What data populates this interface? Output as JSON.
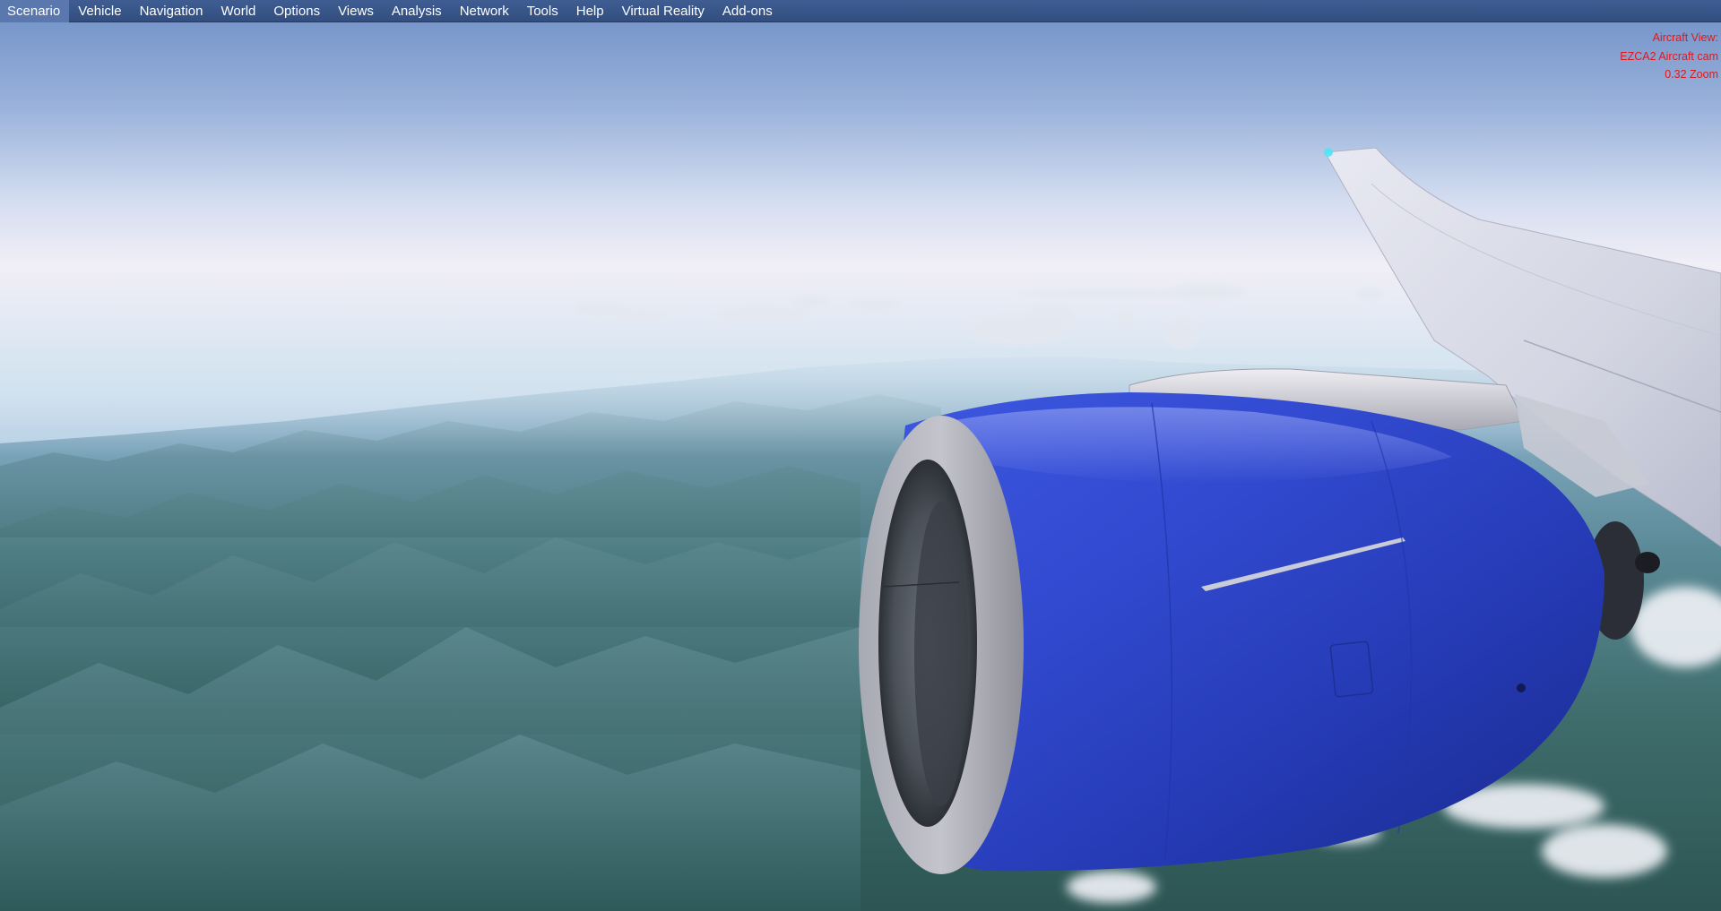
{
  "menu": {
    "items": [
      {
        "id": "scenario",
        "label": "Scenario"
      },
      {
        "id": "vehicle",
        "label": "Vehicle"
      },
      {
        "id": "navigation",
        "label": "Navigation"
      },
      {
        "id": "world",
        "label": "World"
      },
      {
        "id": "options",
        "label": "Options"
      },
      {
        "id": "views",
        "label": "Views"
      },
      {
        "id": "analysis",
        "label": "Analysis"
      },
      {
        "id": "network",
        "label": "Network"
      },
      {
        "id": "tools",
        "label": "Tools"
      },
      {
        "id": "help",
        "label": "Help"
      },
      {
        "id": "virtual-reality",
        "label": "Virtual Reality"
      },
      {
        "id": "add-ons",
        "label": "Add-ons"
      }
    ]
  },
  "overlay": {
    "line1": "Aircraft View:",
    "line2": "EZCA2 Aircraft cam",
    "line3": "0.32 Zoom"
  },
  "colors": {
    "menubar": "#3a578b",
    "overlay_text": "#e0181c",
    "engine_nacelle": "#2c45c8",
    "sky_top": "#7e9ed0",
    "terrain": "#3f6b6a"
  }
}
